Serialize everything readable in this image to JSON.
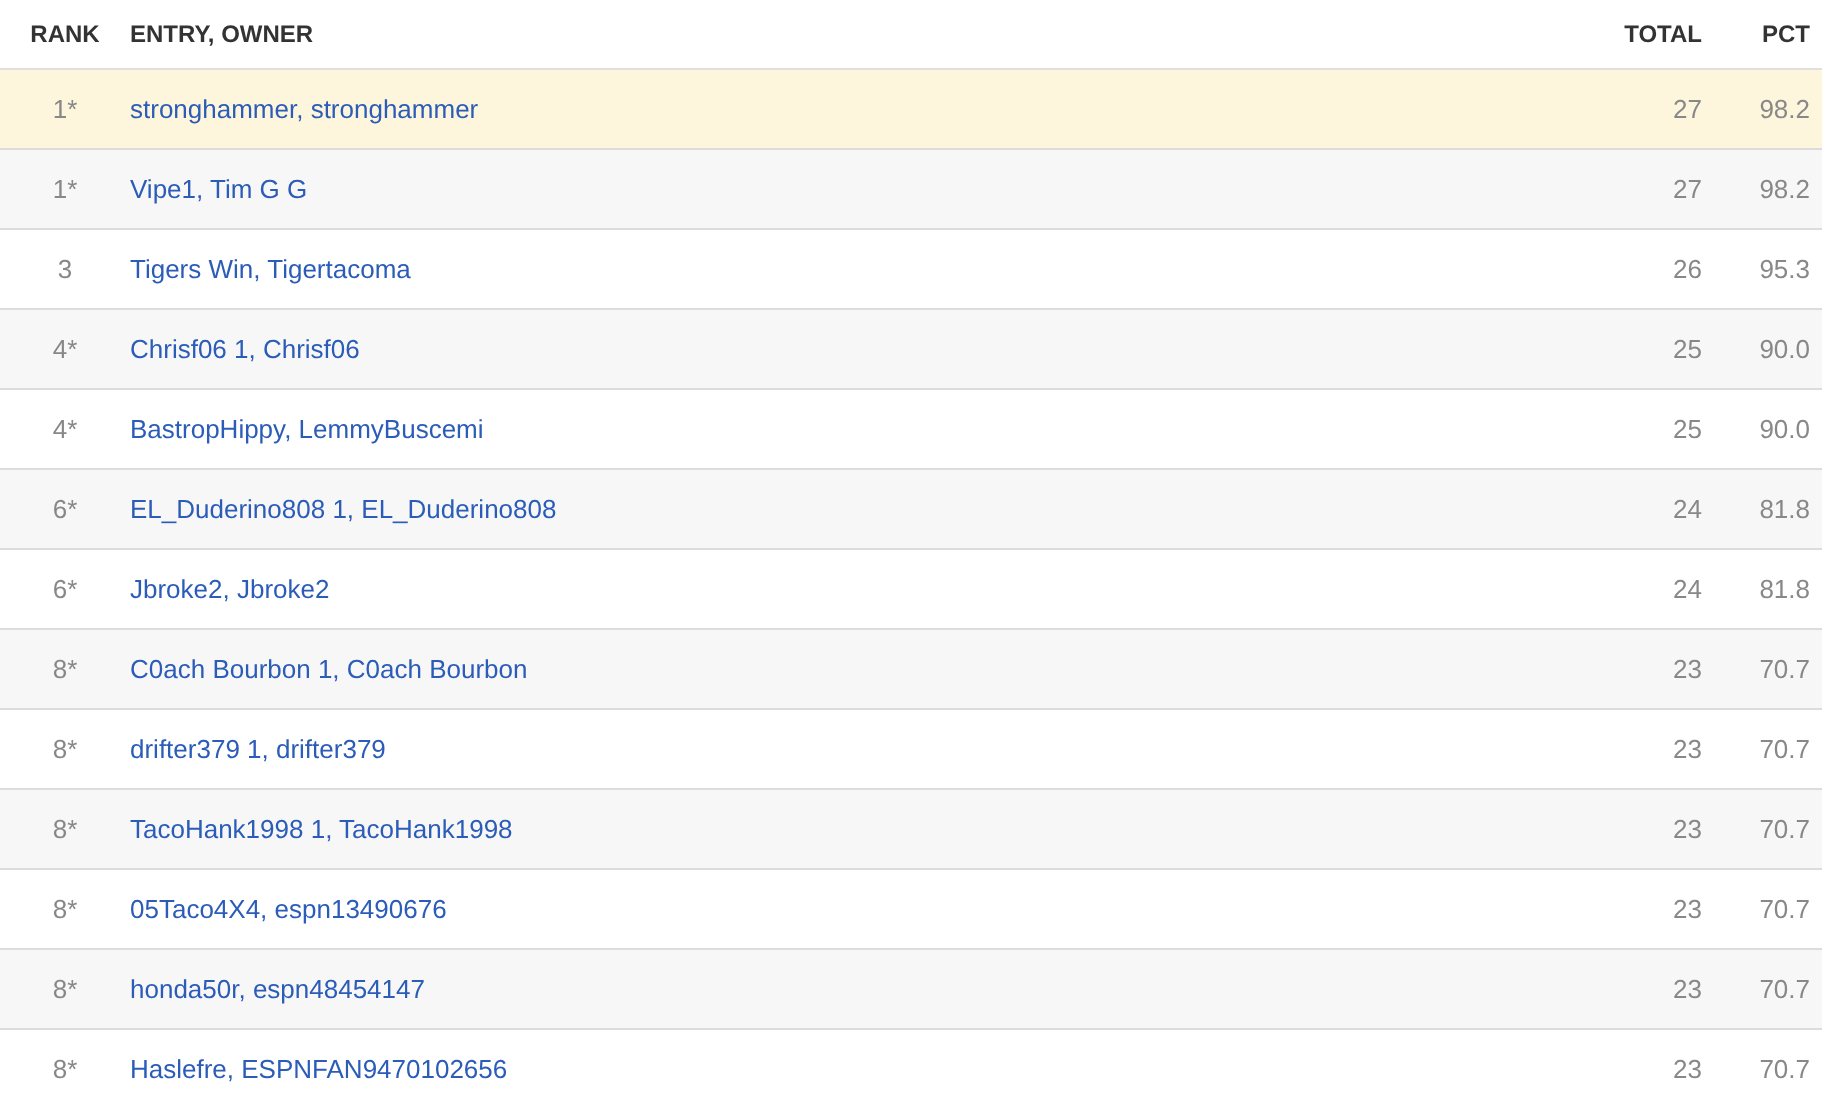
{
  "table": {
    "columns": [
      "RANK",
      "ENTRY, OWNER",
      "TOTAL",
      "PCT"
    ],
    "rows": [
      {
        "rank": "1*",
        "entry": "stronghammer, stronghammer",
        "total": "27",
        "pct": "98.2",
        "selected": true
      },
      {
        "rank": "1*",
        "entry": "Vipe1, Tim G G",
        "total": "27",
        "pct": "98.2",
        "selected": false
      },
      {
        "rank": "3",
        "entry": "Tigers Win, Tigertacoma",
        "total": "26",
        "pct": "95.3",
        "selected": false
      },
      {
        "rank": "4*",
        "entry": "Chrisf06 1, Chrisf06",
        "total": "25",
        "pct": "90.0",
        "selected": false
      },
      {
        "rank": "4*",
        "entry": "BastropHippy, LemmyBuscemi",
        "total": "25",
        "pct": "90.0",
        "selected": false
      },
      {
        "rank": "6*",
        "entry": "EL_Duderino808 1, EL_Duderino808",
        "total": "24",
        "pct": "81.8",
        "selected": false
      },
      {
        "rank": "6*",
        "entry": "Jbroke2, Jbroke2",
        "total": "24",
        "pct": "81.8",
        "selected": false
      },
      {
        "rank": "8*",
        "entry": "C0ach Bourbon 1, C0ach Bourbon",
        "total": "23",
        "pct": "70.7",
        "selected": false
      },
      {
        "rank": "8*",
        "entry": "drifter379 1, drifter379",
        "total": "23",
        "pct": "70.7",
        "selected": false
      },
      {
        "rank": "8*",
        "entry": "TacoHank1998 1, TacoHank1998",
        "total": "23",
        "pct": "70.7",
        "selected": false
      },
      {
        "rank": "8*",
        "entry": "05Taco4X4, espn13490676",
        "total": "23",
        "pct": "70.7",
        "selected": false
      },
      {
        "rank": "8*",
        "entry": "honda50r, espn48454147",
        "total": "23",
        "pct": "70.7",
        "selected": false
      },
      {
        "rank": "8*",
        "entry": "Haslefre, ESPNFAN9470102656",
        "total": "23",
        "pct": "70.7",
        "selected": false
      }
    ]
  }
}
